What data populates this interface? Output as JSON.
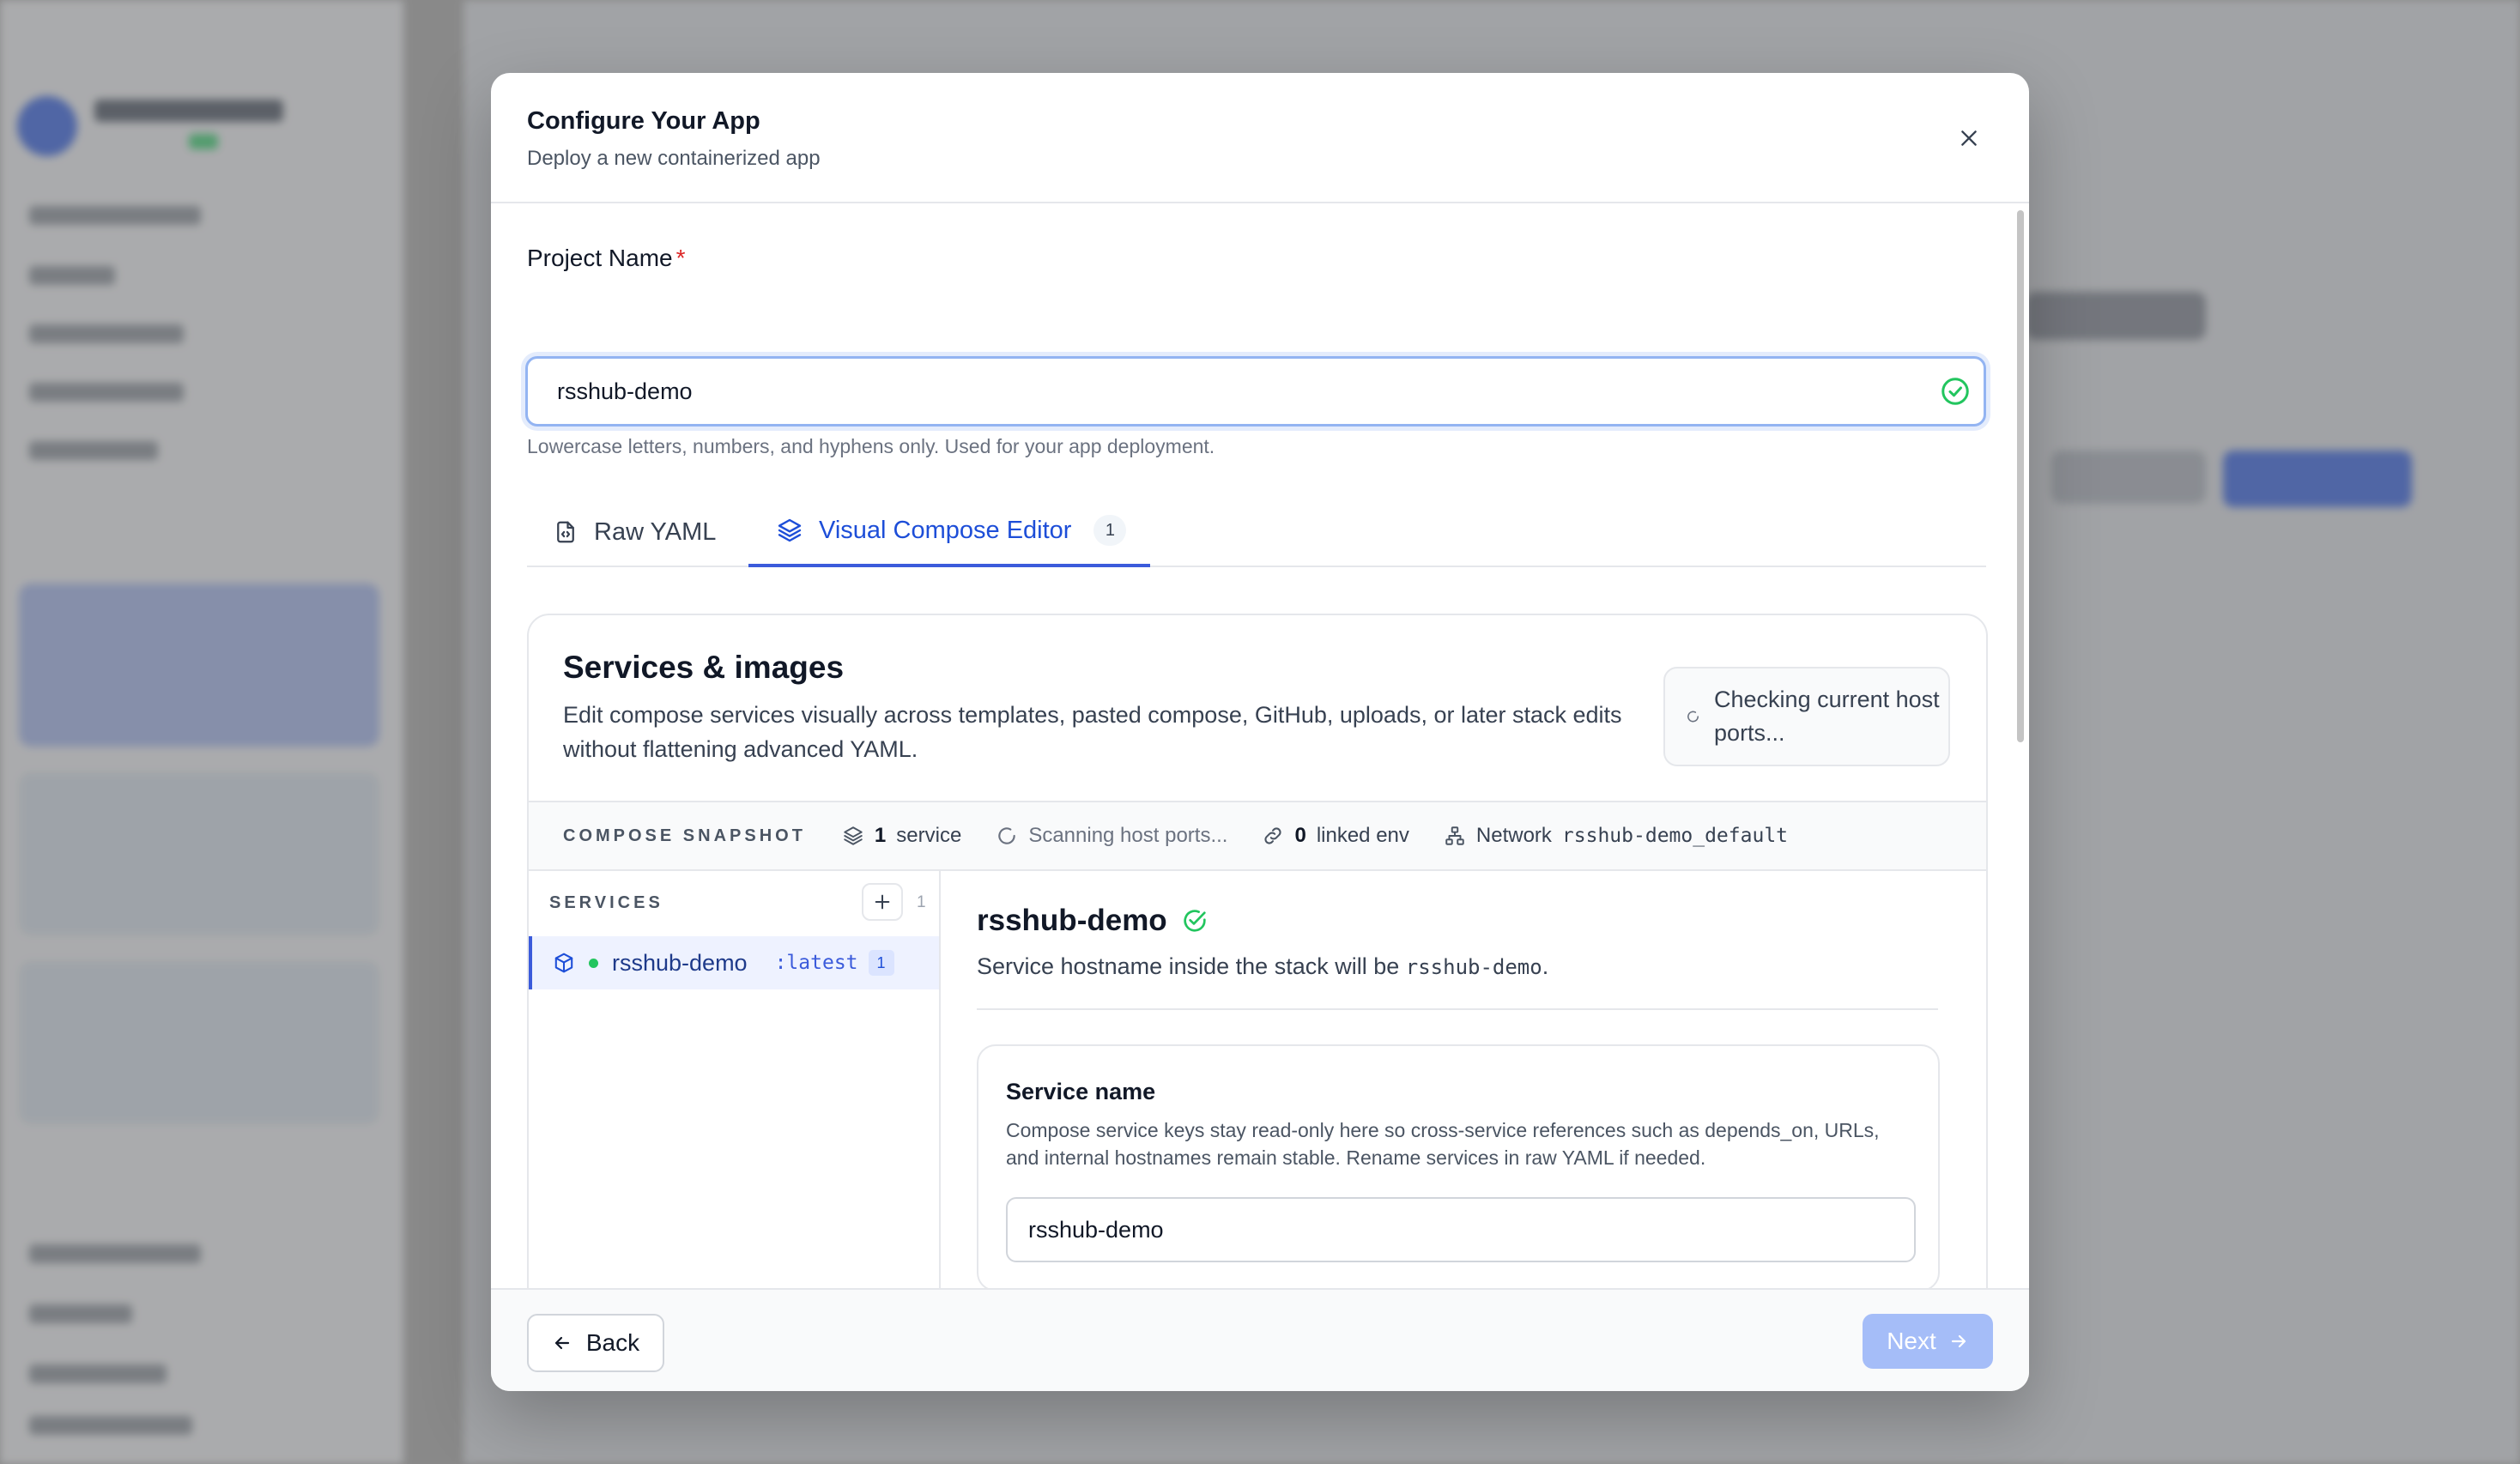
{
  "modal": {
    "title": "Configure Your App",
    "subtitle": "Deploy a new containerized app"
  },
  "project_name": {
    "label": "Project Name",
    "required_mark": "*",
    "value": "rsshub-demo",
    "help": "Lowercase letters, numbers, and hyphens only. Used for your app deployment."
  },
  "tabs": [
    {
      "label": "Raw YAML",
      "active": false
    },
    {
      "label": "Visual Compose Editor",
      "active": true,
      "badge": "1"
    }
  ],
  "editor": {
    "title": "Services & images",
    "description": "Edit compose services visually across templates, pasted compose, GitHub, uploads, or later stack edits without flattening advanced YAML.",
    "ports_status": "Checking current host ports...",
    "snapshot": {
      "label": "COMPOSE SNAPSHOT",
      "service_count": "1",
      "service_word": "service",
      "scan_status": "Scanning host ports...",
      "linked_env_count": "0",
      "linked_env_word": "linked env",
      "network_label": "Network",
      "network_name": "rsshub-demo_default"
    },
    "services_panel": {
      "heading": "SERVICES",
      "count": "1",
      "items": [
        {
          "name": "rsshub-demo",
          "tag": ":latest",
          "count": "1",
          "status_color": "#22c55e"
        }
      ]
    },
    "detail": {
      "title": "rsshub-demo",
      "hostname_prefix": "Service hostname inside the stack will be",
      "hostname": "rsshub-demo",
      "hostname_suffix": ".",
      "service_name_card": {
        "title": "Service name",
        "description": "Compose service keys stay read-only here so cross-service references such as depends_on, URLs, and internal hostnames remain stable. Rename services in raw YAML if needed.",
        "value": "rsshub-demo"
      }
    }
  },
  "footer": {
    "back_label": "Back",
    "next_label": "Next"
  },
  "colors": {
    "accent": "#3b5bdb",
    "success": "#22c55e",
    "required": "#dc2626",
    "next_disabled": "#a5bdf8"
  }
}
